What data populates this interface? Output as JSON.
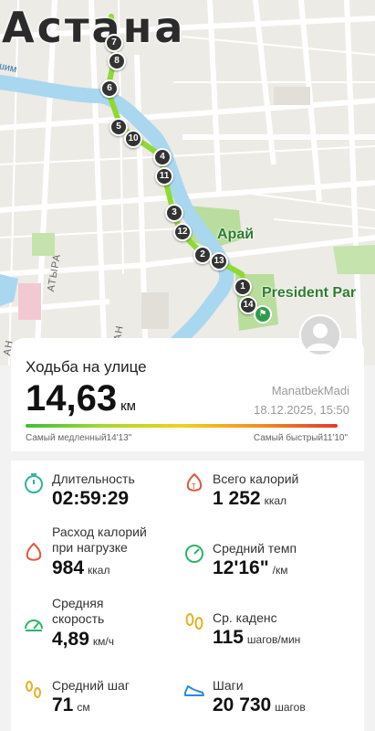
{
  "map": {
    "city": "Астана",
    "park_label": "Арай",
    "park2_label": "President Par",
    "street_label": "АТЫРА",
    "river_label": "шим",
    "street2_label": "АН",
    "street3_label": "АН",
    "markers": [
      "7",
      "8",
      "6",
      "5",
      "10",
      "4",
      "11",
      "3",
      "12",
      "2",
      "13",
      "1",
      "14"
    ]
  },
  "workout": {
    "type": "Ходьба на улице",
    "distance": "14,63",
    "distance_unit": "км",
    "user": "ManatbekMadi",
    "datetime": "18.12.2025, 15:50",
    "slowest": "Самый медленный14'13\"",
    "fastest": "Самый быстрый11'10\""
  },
  "stats": {
    "duration": {
      "label": "Длительность",
      "value": "02:59:29",
      "unit": ""
    },
    "total_cal": {
      "label": "Всего калорий",
      "value": "1 252",
      "unit": "ккал"
    },
    "active_cal": {
      "label1": "Расход калорий",
      "label2": "при нагрузке",
      "value": "984",
      "unit": "ккал"
    },
    "avg_pace": {
      "label": "Средний темп",
      "value": "12'16\"",
      "unit": "/км"
    },
    "avg_speed": {
      "label1": "Средняя",
      "label2": "скорость",
      "value": "4,89",
      "unit": "км/ч"
    },
    "cadence": {
      "label": "Ср. каденс",
      "value": "115",
      "unit": "шагов/мин"
    },
    "stride": {
      "label": "Средний шаг",
      "value": "71",
      "unit": "см"
    },
    "steps": {
      "label": "Шаги",
      "value": "20 730",
      "unit": "шагов"
    }
  },
  "colors": {
    "accent_green": "#2e9d4b",
    "route": "#8fd932",
    "river": "#a9d7f0"
  }
}
